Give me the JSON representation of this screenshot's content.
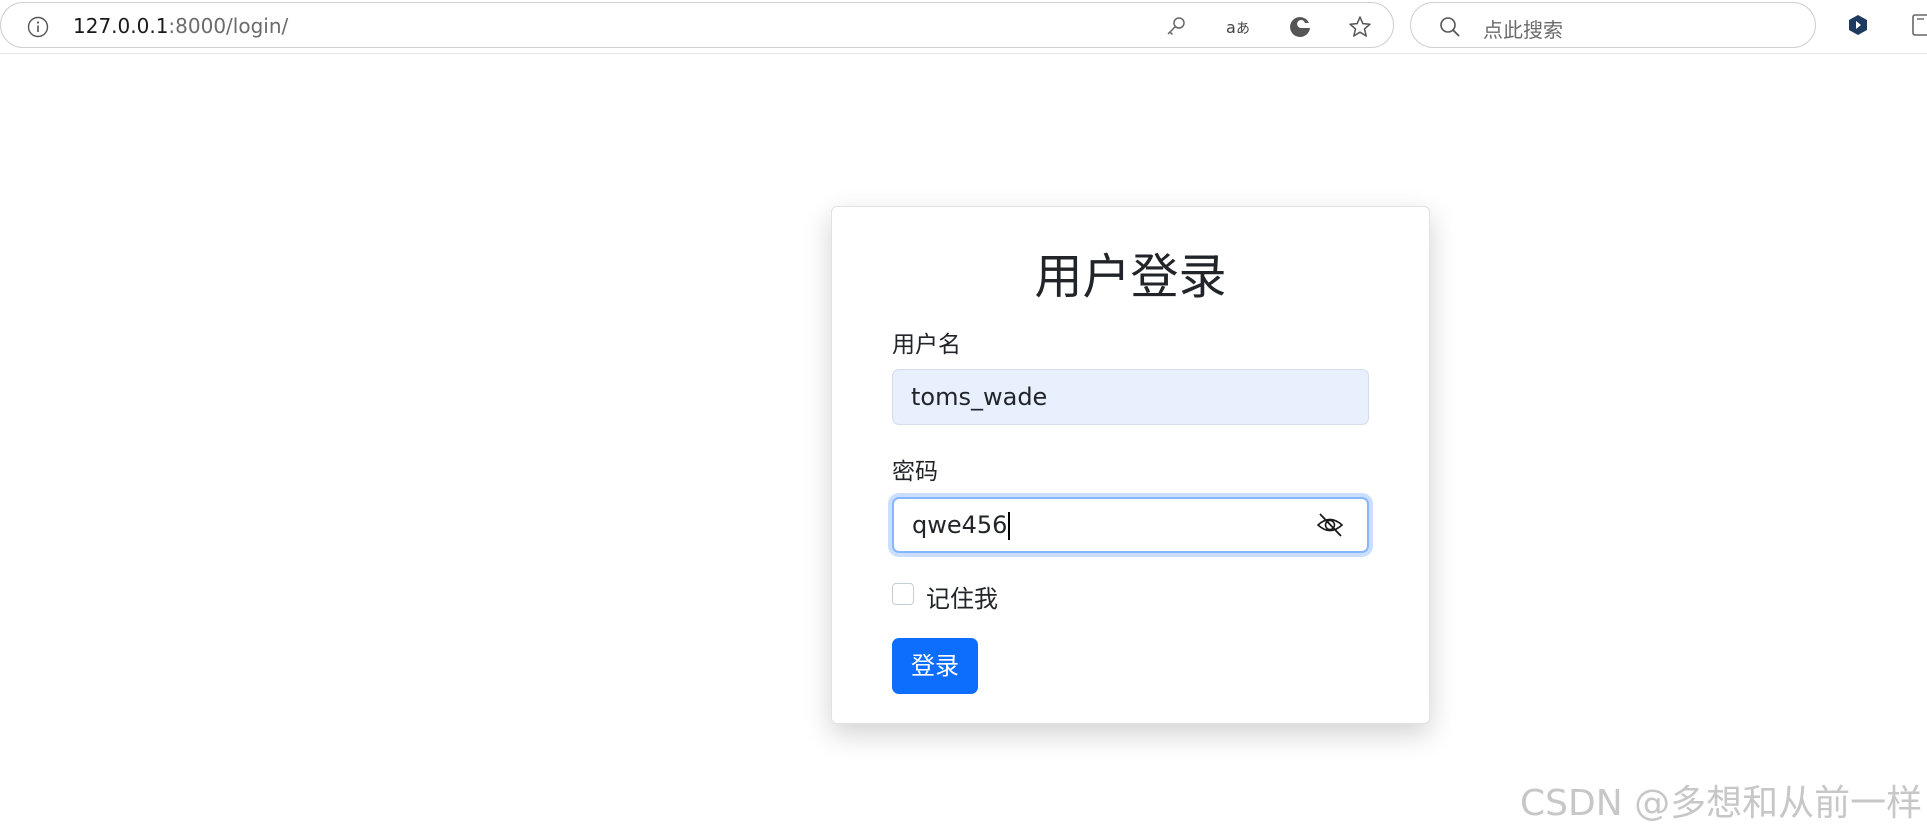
{
  "browser": {
    "url_host": "127.0.0.1",
    "url_path": ":8000/login/",
    "search_placeholder": "点此搜索"
  },
  "login": {
    "title": "用户登录",
    "username_label": "用户名",
    "username_value": "toms_wade",
    "password_label": "密码",
    "password_value": "qwe456",
    "remember_label": "记住我",
    "remember_checked": false,
    "submit_label": "登录"
  },
  "watermark": "CSDN @多想和从前一样",
  "colors": {
    "primary_button": "#0d6efd",
    "autofill_background": "#e8f0fe",
    "focus_border": "#86b7fe"
  },
  "icons": [
    "info-icon",
    "key-icon",
    "read-aloud-icon",
    "edge-icon",
    "star-icon",
    "search-icon",
    "extension-icon",
    "sidebar-toggle-icon",
    "eye-off-icon"
  ]
}
